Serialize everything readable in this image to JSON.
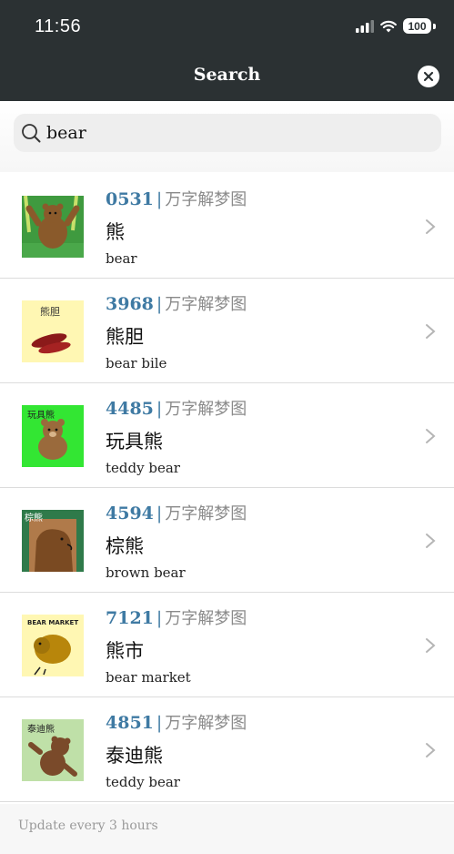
{
  "status_bar": {
    "time": "11:56",
    "battery": "100"
  },
  "nav": {
    "title": "Search"
  },
  "search": {
    "value": "bear",
    "placeholder": ""
  },
  "results": [
    {
      "code": "0531",
      "source": "万字解梦图",
      "title": "熊",
      "subtitle": "bear",
      "thumb_label": ""
    },
    {
      "code": "3968",
      "source": "万字解梦图",
      "title": "熊胆",
      "subtitle": "bear bile",
      "thumb_label": "熊胆"
    },
    {
      "code": "4485",
      "source": "万字解梦图",
      "title": "玩具熊",
      "subtitle": "teddy bear",
      "thumb_label": "玩具熊"
    },
    {
      "code": "4594",
      "source": "万字解梦图",
      "title": "棕熊",
      "subtitle": "brown bear",
      "thumb_label": "棕熊"
    },
    {
      "code": "7121",
      "source": "万字解梦图",
      "title": "熊市",
      "subtitle": "bear market",
      "thumb_label": "BEAR MARKET"
    },
    {
      "code": "4851",
      "source": "万字解梦图",
      "title": "泰迪熊",
      "subtitle": "teddy bear",
      "thumb_label": "泰迪熊"
    }
  ],
  "footer": {
    "text": "Update every 3 hours"
  },
  "colors": {
    "topbar": "#2b3133",
    "accent": "#3f7aa3",
    "footer": "#f7f7f7"
  },
  "icons": [
    "signal-icon",
    "wifi-icon",
    "battery-icon",
    "close-icon",
    "search-icon",
    "chevron-right-icon"
  ]
}
